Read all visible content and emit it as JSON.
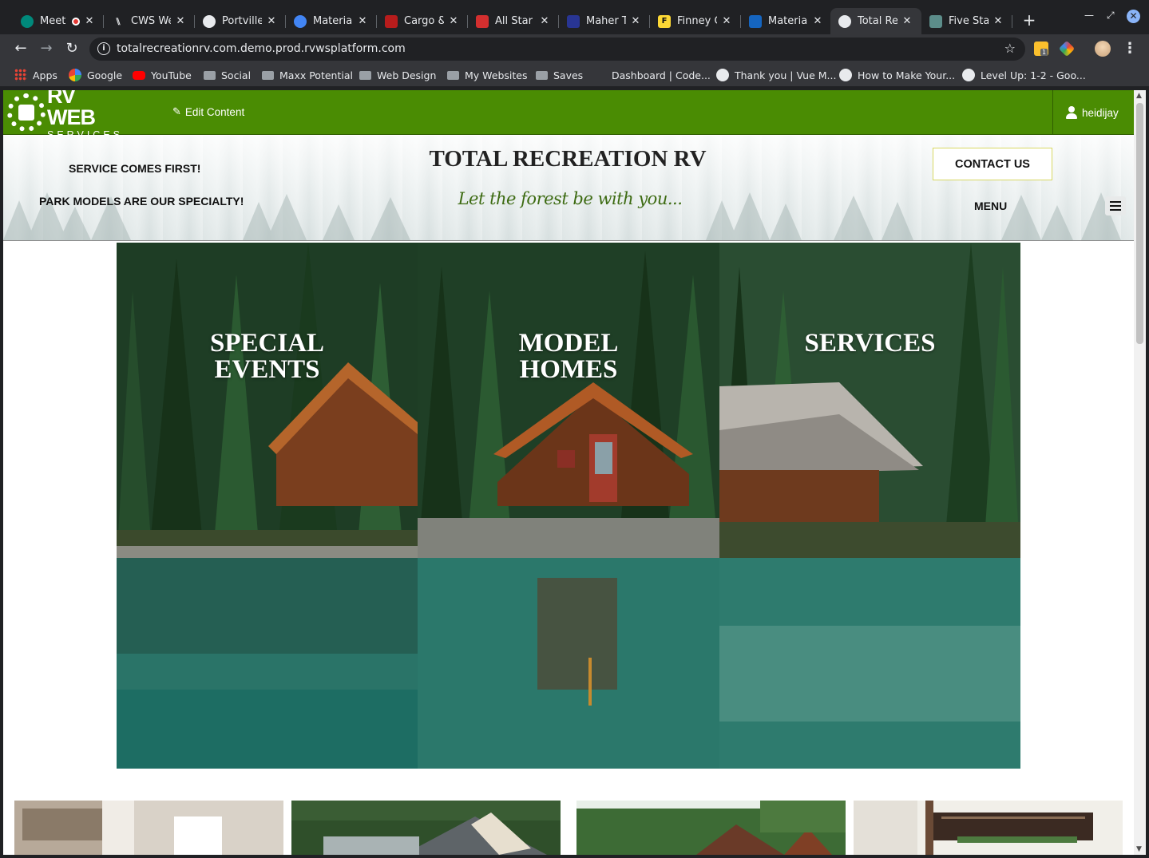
{
  "browser": {
    "tabs": [
      {
        "title": "Meet",
        "favicon_color": "#00897b",
        "recording": true
      },
      {
        "title": "CWS Wel",
        "favicon_color": "#202124"
      },
      {
        "title": "Portville",
        "favicon_color": "#e8eaed"
      },
      {
        "title": "Material",
        "favicon_color": "#4285f4"
      },
      {
        "title": "Cargo &",
        "favicon_color": "#b71c1c"
      },
      {
        "title": "All Star I",
        "favicon_color": "#d32f2f"
      },
      {
        "title": "Maher Tr",
        "favicon_color": "#283593"
      },
      {
        "title": "Finney C",
        "favicon_color": "#fdd835"
      },
      {
        "title": "Material",
        "favicon_color": "#1565c0"
      },
      {
        "title": "Total Rec",
        "favicon_color": "#e8eaed",
        "active": true
      },
      {
        "title": "Five Star",
        "favicon_color": "#5c8d8a"
      }
    ],
    "address": "totalrecreationrv.com.demo.prod.rvwsplatform.com",
    "bookmarks": [
      {
        "label": "Apps",
        "icon": "apps-grid-icon"
      },
      {
        "label": "Google",
        "icon": "google-icon"
      },
      {
        "label": "YouTube",
        "icon": "youtube-icon"
      },
      {
        "label": "Social",
        "icon": "folder-icon"
      },
      {
        "label": "Maxx Potential",
        "icon": "folder-icon"
      },
      {
        "label": "Web Design",
        "icon": "folder-icon"
      },
      {
        "label": "My Websites",
        "icon": "folder-icon"
      },
      {
        "label": "Saves",
        "icon": "folder-icon"
      },
      {
        "label": "Dashboard | Code...",
        "icon": "codepen-icon"
      },
      {
        "label": "Thank you | Vue M...",
        "icon": "globe-icon"
      },
      {
        "label": "How to Make Your...",
        "icon": "globe-icon"
      },
      {
        "label": "Level Up: 1-2 - Goo...",
        "icon": "globe-icon"
      }
    ],
    "extension_badge": "1"
  },
  "admin_bar": {
    "logo_line1": "RV WEB",
    "logo_line2": "SERVICES",
    "edit_label": "Edit Content",
    "username": "heidijay",
    "bar_color": "#4a8c03"
  },
  "site_header": {
    "tagline1": "SERVICE COMES FIRST!",
    "tagline2": "PARK MODELS ARE OUR SPECIALTY!",
    "title": "TOTAL RECREATION RV",
    "slogan": "Let the forest be with you...",
    "contact_label": "CONTACT US",
    "menu_label": "MENU",
    "slogan_color": "#3d6b12"
  },
  "hero_panels": [
    {
      "title": "SPECIAL\nEVENTS"
    },
    {
      "title": "MODEL\nHOMES"
    },
    {
      "title": "SERVICES"
    }
  ]
}
